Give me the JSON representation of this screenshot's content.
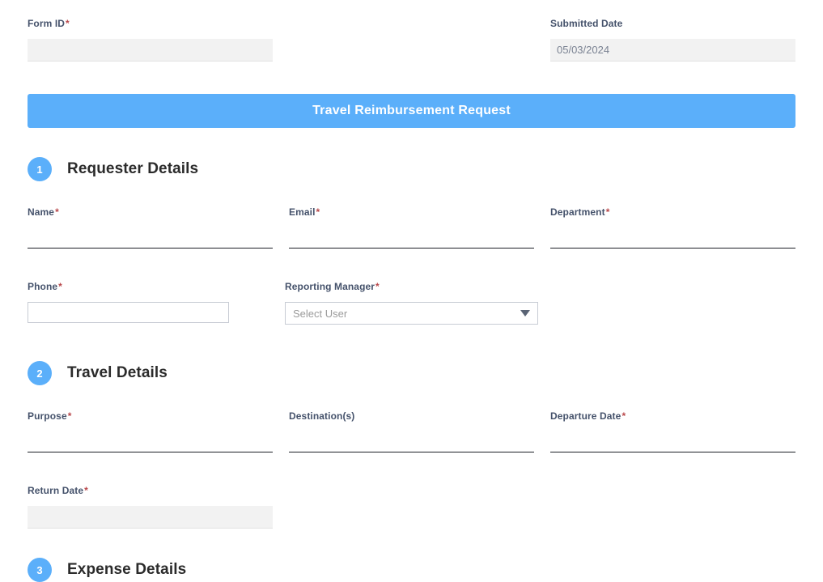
{
  "banner": {
    "title": "Travel Reimbursement Request",
    "color": "#5BAFFA"
  },
  "top_fields": {
    "form_id": {
      "label": "Form ID",
      "required": "*",
      "value": "",
      "placeholder": ""
    },
    "submitted_date": {
      "label": "Submitted Date",
      "required": "",
      "value": "05/03/2024",
      "placeholder": ""
    }
  },
  "sections": [
    {
      "number": "1",
      "title": "Requester Details",
      "fields": [
        {
          "label": "Name",
          "required": "*",
          "value": "",
          "placeholder": ""
        },
        {
          "label": "Email",
          "required": "*",
          "value": "",
          "placeholder": ""
        },
        {
          "label": "Department",
          "required": "*",
          "value": "",
          "placeholder": ""
        },
        {
          "label": "Phone",
          "required": "*",
          "value": "",
          "placeholder": ""
        },
        {
          "label": "Reporting Manager",
          "required": "*",
          "value": "",
          "placeholder": "Select User"
        }
      ]
    },
    {
      "number": "2",
      "title": "Travel Details",
      "fields": [
        {
          "label": "Purpose",
          "required": "*",
          "value": "",
          "placeholder": ""
        },
        {
          "label": "Destination(s)",
          "required": "",
          "value": "",
          "placeholder": ""
        },
        {
          "label": "Departure Date",
          "required": "*",
          "value": "",
          "placeholder": ""
        },
        {
          "label": "Return Date",
          "required": "*",
          "value": "",
          "placeholder": ""
        }
      ]
    },
    {
      "number": "3",
      "title": "Expense Details",
      "fields": []
    }
  ],
  "select_options": {
    "reporting_manager": [
      "Select User"
    ]
  },
  "icons": {
    "dropdown": "chevron-down-icon"
  }
}
